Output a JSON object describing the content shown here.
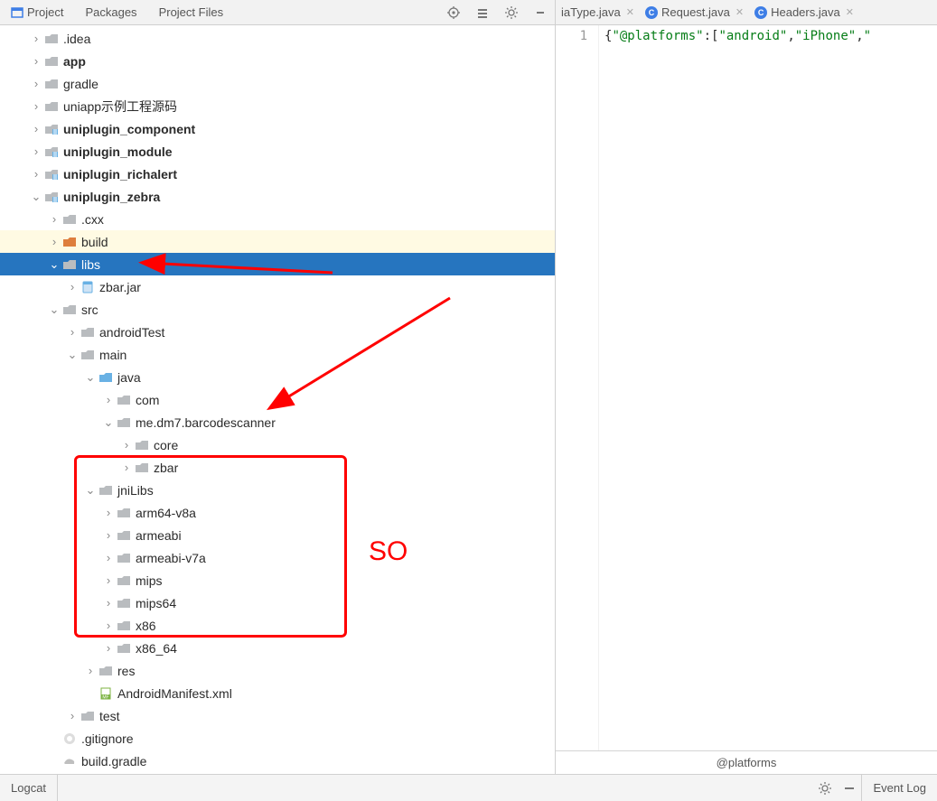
{
  "topTabs": [
    {
      "label": "Project",
      "icon": "project-icon",
      "iconColor": "#3e7ee6"
    },
    {
      "label": "Packages",
      "icon": null
    },
    {
      "label": "Project Files",
      "icon": null
    }
  ],
  "editorTabs": [
    {
      "label": "iaType.java"
    },
    {
      "label": "Request.java"
    },
    {
      "label": "Headers.java"
    }
  ],
  "gutterLine": "1",
  "code": {
    "parts": [
      {
        "cls": "tok-brace",
        "text": "{"
      },
      {
        "cls": "tok-key",
        "text": "\"@platforms\""
      },
      {
        "cls": "tok-brace",
        "text": ":["
      },
      {
        "cls": "tok-str",
        "text": "\"android\""
      },
      {
        "cls": "tok-brace",
        "text": ","
      },
      {
        "cls": "tok-str",
        "text": "\"iPhone\""
      },
      {
        "cls": "tok-brace",
        "text": ","
      },
      {
        "cls": "tok-str",
        "text": "\""
      }
    ]
  },
  "breadcrumb": "@platforms",
  "bottomBar": {
    "left": "Logcat",
    "right": "Event Log"
  },
  "annotation": {
    "soLabel": "SO"
  },
  "tree": [
    {
      "indent": 1,
      "arrow": ">",
      "icon": "folder",
      "label": ".idea",
      "bold": false
    },
    {
      "indent": 1,
      "arrow": ">",
      "icon": "folder",
      "label": "app",
      "bold": true
    },
    {
      "indent": 1,
      "arrow": ">",
      "icon": "folder",
      "label": "gradle",
      "bold": false
    },
    {
      "indent": 1,
      "arrow": ">",
      "icon": "folder",
      "label": "uniapp示例工程源码",
      "bold": false
    },
    {
      "indent": 1,
      "arrow": ">",
      "icon": "module",
      "label": "uniplugin_component",
      "bold": true
    },
    {
      "indent": 1,
      "arrow": ">",
      "icon": "module",
      "label": "uniplugin_module",
      "bold": true
    },
    {
      "indent": 1,
      "arrow": ">",
      "icon": "module",
      "label": "uniplugin_richalert",
      "bold": true
    },
    {
      "indent": 1,
      "arrow": "v",
      "icon": "module",
      "label": "uniplugin_zebra",
      "bold": true
    },
    {
      "indent": 2,
      "arrow": ">",
      "icon": "folder",
      "label": ".cxx",
      "bold": false
    },
    {
      "indent": 2,
      "arrow": ">",
      "icon": "folder-build",
      "label": "build",
      "bold": false,
      "highlight": true
    },
    {
      "indent": 2,
      "arrow": "v",
      "icon": "folder",
      "label": "libs",
      "bold": false,
      "selected": true
    },
    {
      "indent": 3,
      "arrow": ">",
      "icon": "jar",
      "label": "zbar.jar",
      "bold": false
    },
    {
      "indent": 2,
      "arrow": "v",
      "icon": "folder",
      "label": "src",
      "bold": false
    },
    {
      "indent": 3,
      "arrow": ">",
      "icon": "folder",
      "label": "androidTest",
      "bold": false
    },
    {
      "indent": 3,
      "arrow": "v",
      "icon": "folder",
      "label": "main",
      "bold": false
    },
    {
      "indent": 4,
      "arrow": "v",
      "icon": "folder-src",
      "label": "java",
      "bold": false
    },
    {
      "indent": 5,
      "arrow": ">",
      "icon": "package",
      "label": "com",
      "bold": false
    },
    {
      "indent": 5,
      "arrow": "v",
      "icon": "package",
      "label": "me.dm7.barcodescanner",
      "bold": false
    },
    {
      "indent": 6,
      "arrow": ">",
      "icon": "package",
      "label": "core",
      "bold": false
    },
    {
      "indent": 6,
      "arrow": ">",
      "icon": "package",
      "label": "zbar",
      "bold": false
    },
    {
      "indent": 4,
      "arrow": "v",
      "icon": "folder",
      "label": "jniLibs",
      "bold": false
    },
    {
      "indent": 5,
      "arrow": ">",
      "icon": "folder",
      "label": "arm64-v8a",
      "bold": false
    },
    {
      "indent": 5,
      "arrow": ">",
      "icon": "folder",
      "label": "armeabi",
      "bold": false
    },
    {
      "indent": 5,
      "arrow": ">",
      "icon": "folder",
      "label": "armeabi-v7a",
      "bold": false
    },
    {
      "indent": 5,
      "arrow": ">",
      "icon": "folder",
      "label": "mips",
      "bold": false
    },
    {
      "indent": 5,
      "arrow": ">",
      "icon": "folder",
      "label": "mips64",
      "bold": false
    },
    {
      "indent": 5,
      "arrow": ">",
      "icon": "folder",
      "label": "x86",
      "bold": false
    },
    {
      "indent": 5,
      "arrow": ">",
      "icon": "folder",
      "label": "x86_64",
      "bold": false
    },
    {
      "indent": 4,
      "arrow": ">",
      "icon": "folder-res",
      "label": "res",
      "bold": false
    },
    {
      "indent": 4,
      "arrow": "",
      "icon": "manifest",
      "label": "AndroidManifest.xml",
      "bold": false
    },
    {
      "indent": 3,
      "arrow": ">",
      "icon": "folder",
      "label": "test",
      "bold": false
    },
    {
      "indent": 2,
      "arrow": "",
      "icon": "gitignore",
      "label": ".gitignore",
      "bold": false
    },
    {
      "indent": 2,
      "arrow": "",
      "icon": "gradle",
      "label": "build.gradle",
      "bold": false
    }
  ]
}
